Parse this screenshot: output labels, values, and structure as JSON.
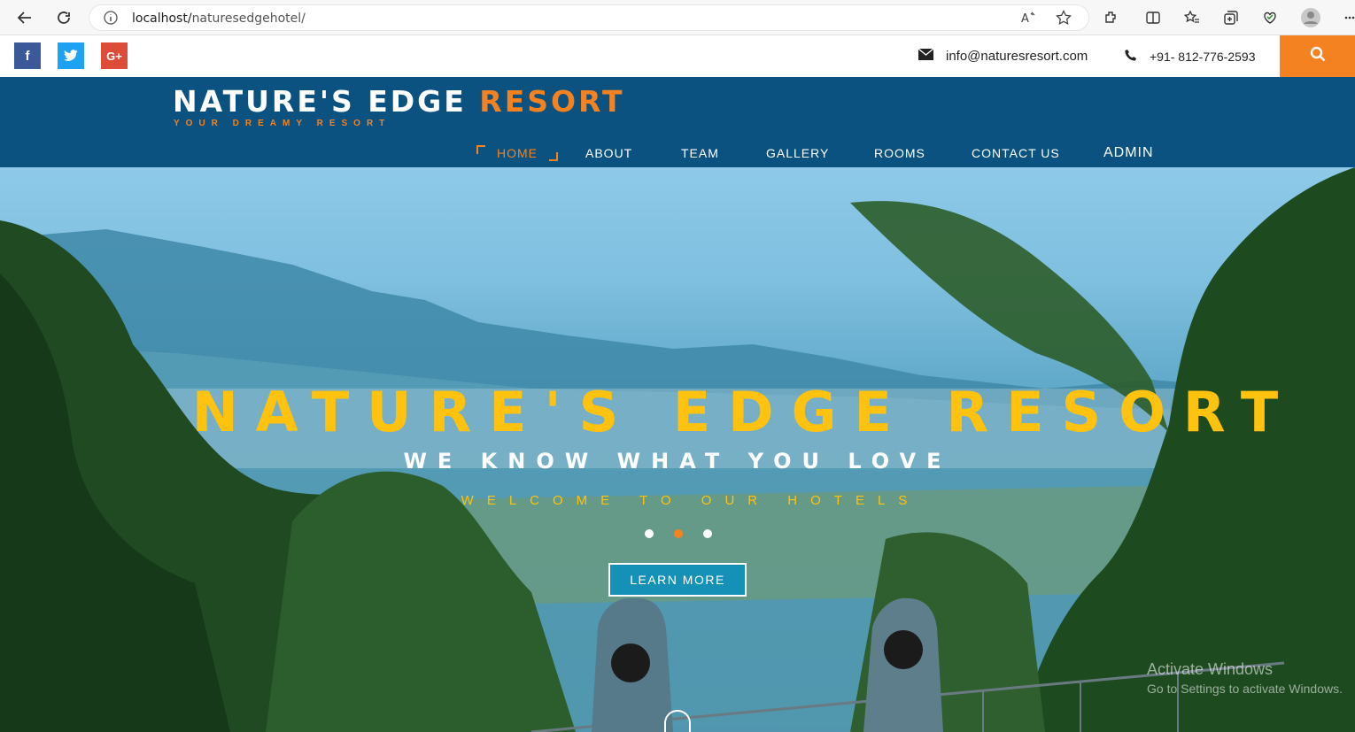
{
  "browser": {
    "url_host": "localhost/",
    "url_path": "naturesedgehotel/"
  },
  "topbar": {
    "social": [
      {
        "name": "facebook",
        "glyph": "f"
      },
      {
        "name": "twitter",
        "glyph": "t"
      },
      {
        "name": "google-plus",
        "glyph": "G+"
      }
    ],
    "email": "info@naturesresort.com",
    "phone": "+91- 812-776-2593"
  },
  "header": {
    "logo_main": "NATURE'S EDGE ",
    "logo_accent": "RESORT",
    "tagline": "YOUR DREAMY RESORT",
    "menu": [
      "HOME",
      "ABOUT",
      "TEAM",
      "GALLERY",
      "ROOMS",
      "CONTACT US",
      "ADMIN"
    ],
    "active_menu": "HOME"
  },
  "hero": {
    "title": "NATURE'S EDGE RESORT",
    "subtitle": "WE KNOW WHAT YOU LOVE",
    "welcome": "WELCOME TO OUR HOTELS",
    "cta": "LEARN MORE",
    "slides": 3,
    "active_slide": 2
  },
  "watermark": {
    "line1": "Activate Windows",
    "line2": "Go to Settings to activate Windows."
  },
  "colors": {
    "accent": "#f58220",
    "header_bg": "#0b5280",
    "hero_title": "#ffc20e",
    "cta_bg": "#1591b8"
  }
}
